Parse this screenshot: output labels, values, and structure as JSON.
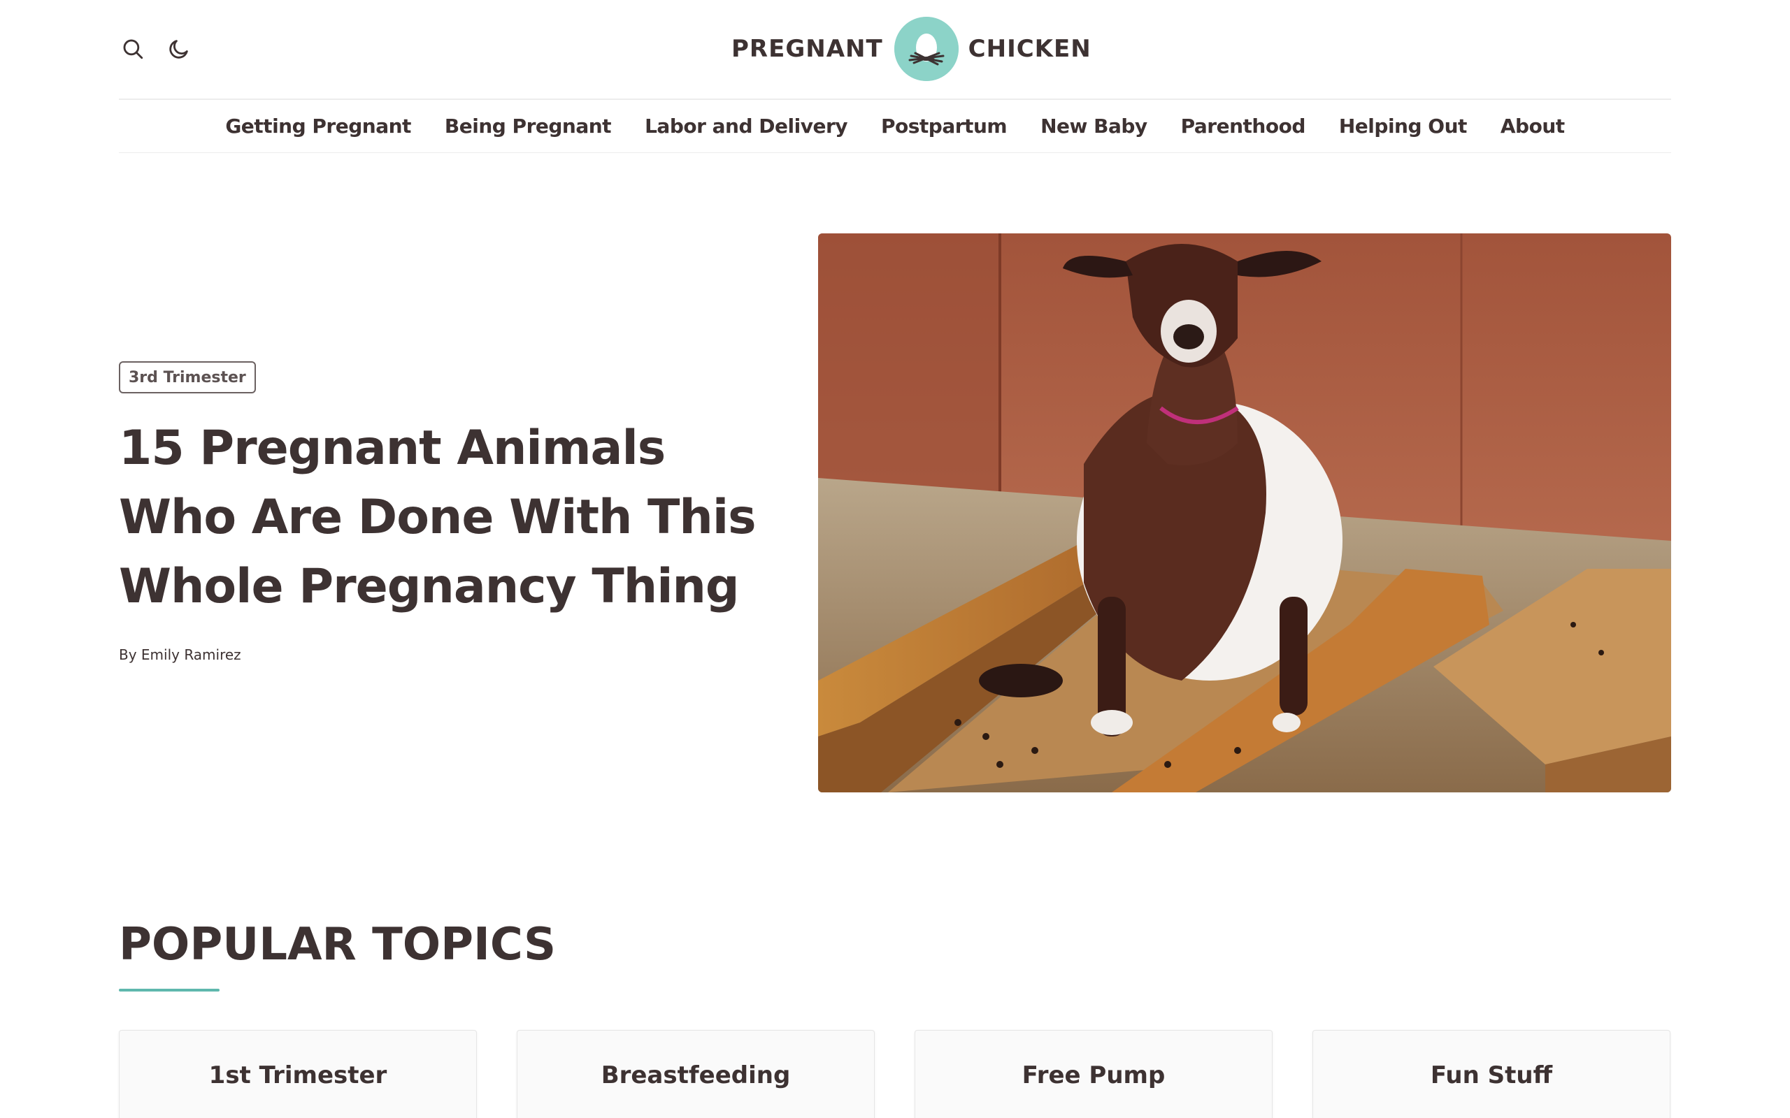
{
  "header": {
    "logo": {
      "left_word": "PREGNANT",
      "right_word": "CHICKEN"
    },
    "icons": {
      "search": "search-icon",
      "theme": "moon-icon"
    }
  },
  "nav": {
    "items": [
      {
        "label": "Getting Pregnant"
      },
      {
        "label": "Being Pregnant"
      },
      {
        "label": "Labor and Delivery"
      },
      {
        "label": "Postpartum"
      },
      {
        "label": "New Baby"
      },
      {
        "label": "Parenthood"
      },
      {
        "label": "Helping Out"
      },
      {
        "label": "About"
      }
    ]
  },
  "hero": {
    "category": "3rd Trimester",
    "title": "15 Pregnant Animals Who Are Done With This Whole Pregnancy Thing",
    "byline": "By Emily Ramirez"
  },
  "popular": {
    "title": "POPULAR TOPICS",
    "topics": [
      {
        "label": "1st Trimester"
      },
      {
        "label": "Breastfeeding"
      },
      {
        "label": "Free Pump"
      },
      {
        "label": "Fun Stuff"
      }
    ]
  },
  "colors": {
    "text": "#3d3232",
    "accent": "#5fb8ad",
    "logo_circle": "#8cd3c8"
  }
}
